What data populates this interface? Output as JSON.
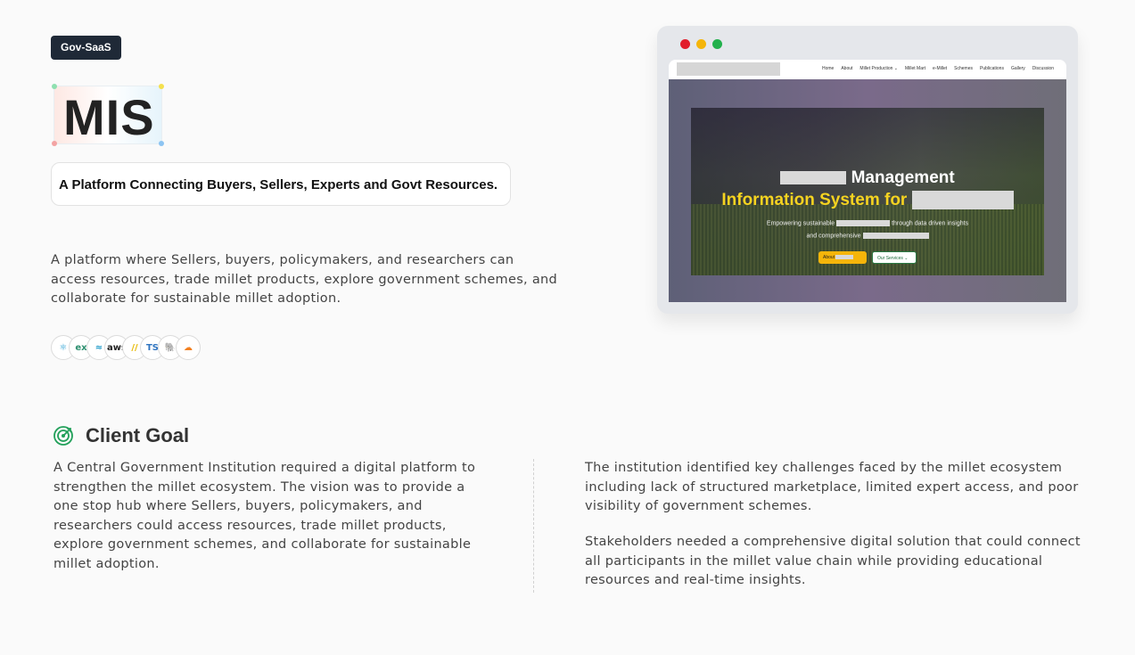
{
  "badge": "Gov-SaaS",
  "logo_text": "MIS",
  "tagline": "A Platform Connecting Buyers, Sellers, Experts and Govt Resources.",
  "intro": "A platform where Sellers, buyers, policymakers, and researchers can access resources, trade millet products, explore government schemes, and collaborate for sustainable millet adoption.",
  "tech_stack": [
    {
      "icon": "react-icon",
      "glyph": "⚛",
      "color": "#1f9bd1"
    },
    {
      "icon": "express-icon",
      "glyph": "ex",
      "color": "#2d8f6f"
    },
    {
      "icon": "tailwind-icon",
      "glyph": "≈",
      "color": "#1696c6"
    },
    {
      "icon": "aws-icon",
      "glyph": "aws",
      "color": "#222222"
    },
    {
      "icon": "vercel-icon",
      "glyph": "//",
      "color": "#e6b800"
    },
    {
      "icon": "typescript-icon",
      "glyph": "TS",
      "color": "#2f74c0"
    },
    {
      "icon": "postgresql-icon",
      "glyph": "🐘",
      "color": "#336791"
    },
    {
      "icon": "cloudflare-icon",
      "glyph": "☁",
      "color": "#f38020"
    }
  ],
  "mockup": {
    "nav_items": [
      "Home",
      "About",
      "Millet Production ⌄",
      "Millet Mart",
      "e-Millet",
      "Schemes",
      "Publications",
      "Gallery",
      "Discussion"
    ],
    "hero_line1": "Management",
    "hero_line2": "Information System for",
    "hero_sub1_a": "Empowering sustainable",
    "hero_sub1_b": "through data driven insights",
    "hero_sub2": "and comprehensive",
    "btn_primary": "About",
    "btn_secondary": "Our Services ⌄"
  },
  "goal": {
    "title": "Client Goal",
    "left": "A Central Government Institution required a digital platform to strengthen the millet ecosystem. The vision was to provide a one stop hub where Sellers, buyers, policymakers, and researchers could access resources, trade millet products, explore government schemes, and collaborate for sustainable millet adoption.",
    "right_p1": "The institution identified key challenges faced by the millet ecosystem including lack of structured marketplace, limited expert access, and poor visibility of government schemes.",
    "right_p2": "Stakeholders needed a comprehensive digital solution that could connect all participants in the millet value chain while providing educational resources and real-time insights."
  },
  "colors": {
    "badge_bg": "#1f2937",
    "accent_green": "#22a05a",
    "hero_yellow": "#f5d320",
    "browser_red": "#e11d2b",
    "browser_yellow": "#f5b50a",
    "browser_green": "#22b14c"
  }
}
